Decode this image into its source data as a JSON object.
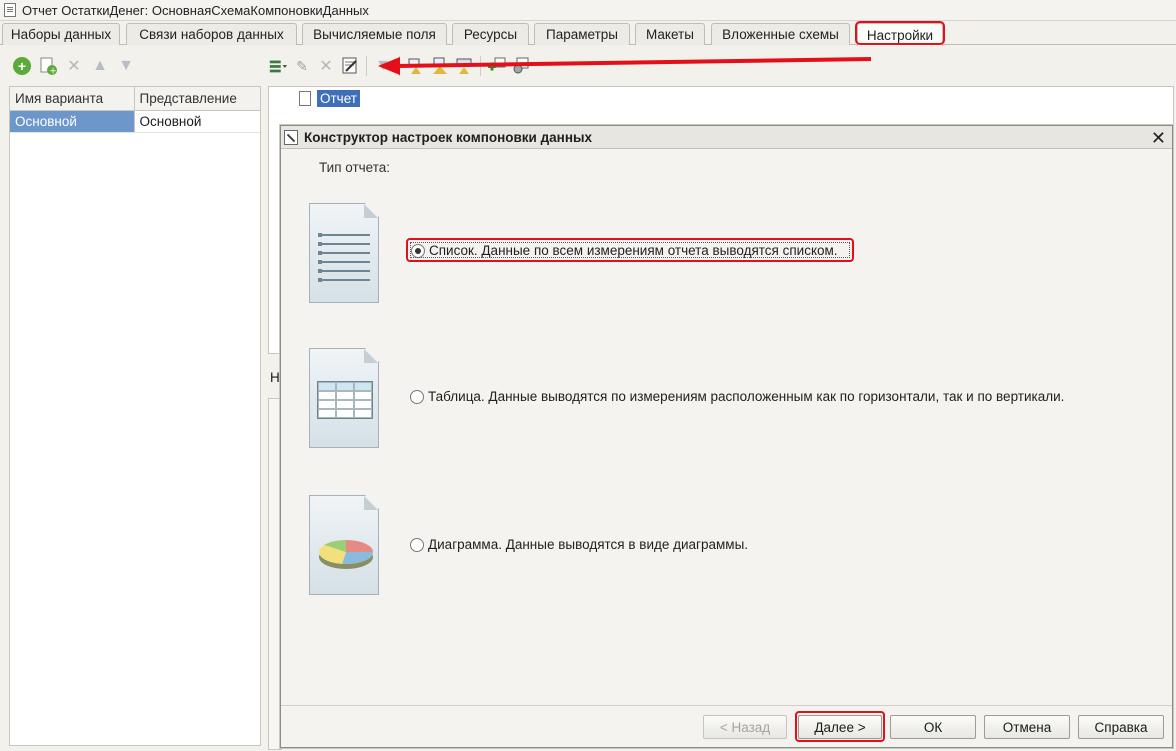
{
  "window": {
    "title": "Отчет ОстаткиДенег: ОсновнаяСхемаКомпоновкиДанных"
  },
  "tabs": [
    {
      "label": "Наборы данных"
    },
    {
      "label": "Связи наборов данных"
    },
    {
      "label": "Вычисляемые поля"
    },
    {
      "label": "Ресурсы"
    },
    {
      "label": "Параметры"
    },
    {
      "label": "Макеты"
    },
    {
      "label": "Вложенные схемы"
    },
    {
      "label": "Настройки"
    }
  ],
  "variants": {
    "columns": [
      "Имя варианта",
      "Представление"
    ],
    "rows": [
      {
        "name": "Основной",
        "presentation": "Основной"
      }
    ]
  },
  "structure": {
    "root_label": "Отчет"
  },
  "under_panel": {
    "label": "Н"
  },
  "dialog": {
    "title": "Конструктор настроек компоновки данных",
    "close_glyph": "✕",
    "type_label": "Тип отчета:",
    "options": [
      {
        "label": "Список. Данные по всем измерениям отчета выводятся списком.",
        "selected": true
      },
      {
        "label": "Таблица. Данные выводятся по измерениям расположенным как по горизонтали, так и по вертикали.",
        "selected": false
      },
      {
        "label": "Диаграмма. Данные выводятся в виде диаграммы.",
        "selected": false
      }
    ],
    "buttons": {
      "back": "< Назад",
      "next": "Далее >",
      "ok": "ОК",
      "cancel": "Отмена",
      "help": "Справка"
    }
  },
  "colors": {
    "highlight": "#e3101a",
    "selection": "#6d97cb"
  }
}
